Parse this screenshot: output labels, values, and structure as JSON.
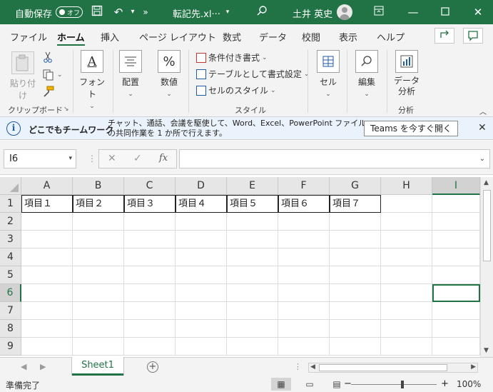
{
  "titlebar": {
    "autosave_label": "自動保存",
    "autosave_state": "オフ",
    "filename": "転記先.xl···",
    "user_name": "土井 英史",
    "bg_color": "#217346"
  },
  "tabs": [
    "ファイル",
    "ホーム",
    "挿入",
    "ページ レイアウト",
    "数式",
    "データ",
    "校閲",
    "表示",
    "ヘルプ"
  ],
  "active_tab": "ホーム",
  "ribbon": {
    "paste": "貼り付け",
    "clipboard_group": "クリップボード",
    "font": "フォント",
    "alignment": "配置",
    "number": "数値",
    "cond_format": "条件付き書式",
    "table_format": "テーブルとして書式設定",
    "cell_style": "セルのスタイル",
    "style_group": "スタイル",
    "cells": "セル",
    "editing": "編集",
    "data_analysis_1": "データ",
    "data_analysis_2": "分析",
    "analysis_group": "分析"
  },
  "infobar": {
    "title": "どこでもチームワーク",
    "message_line1": "チャット、通話、会議を駆使して、Word、Excel、PowerPoint ファイル",
    "message_line2": "の共同作業を 1 か所で行えます。",
    "button": "Teams を今すぐ開く"
  },
  "formula_bar": {
    "name_box": "I6",
    "formula": ""
  },
  "columns": [
    "A",
    "B",
    "C",
    "D",
    "E",
    "F",
    "G",
    "H",
    "I"
  ],
  "rows": [
    "1",
    "2",
    "3",
    "4",
    "5",
    "6",
    "7",
    "8",
    "9"
  ],
  "row1": [
    "項目１",
    "項目２",
    "項目３",
    "項目４",
    "項目５",
    "項目６",
    "項目７"
  ],
  "active_cell": "I6",
  "sheet_tab": "Sheet1",
  "status": {
    "ready": "準備完了",
    "zoom": "100%"
  }
}
